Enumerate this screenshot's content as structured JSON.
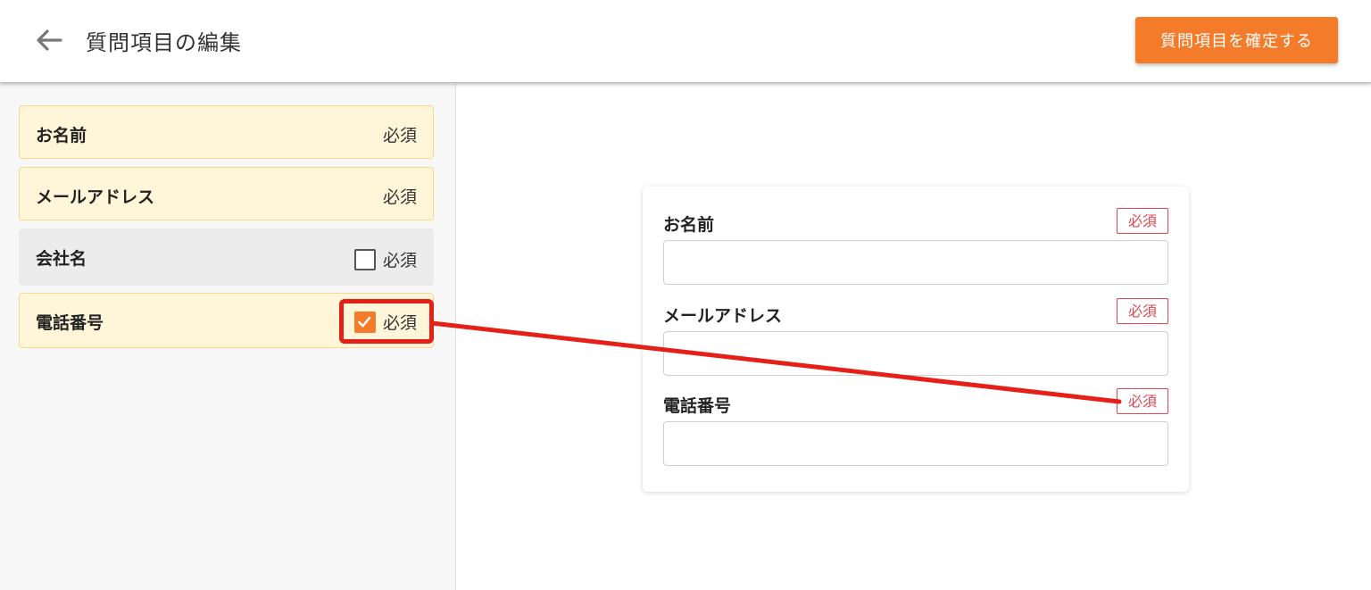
{
  "header": {
    "back_icon": "arrow-left-icon",
    "title": "質問項目の編集",
    "confirm_label": "質問項目を確定する"
  },
  "sidebar": {
    "items": [
      {
        "label": "お名前",
        "required_label": "必須",
        "state": "fixed-required"
      },
      {
        "label": "メールアドレス",
        "required_label": "必須",
        "state": "fixed-required"
      },
      {
        "label": "会社名",
        "required_label": "必須",
        "state": "unchecked"
      },
      {
        "label": "電話番号",
        "required_label": "必須",
        "state": "checked"
      }
    ]
  },
  "preview": {
    "fields": [
      {
        "label": "お名前",
        "badge": "必須",
        "value": ""
      },
      {
        "label": "メールアドレス",
        "badge": "必須",
        "value": ""
      },
      {
        "label": "電話番号",
        "badge": "必須",
        "value": ""
      }
    ]
  },
  "colors": {
    "accent": "#f47b2a",
    "required_bg": "#fff5d8",
    "required_border": "#f6d98a",
    "badge": "#e0474f",
    "annotation": "#e52018"
  }
}
